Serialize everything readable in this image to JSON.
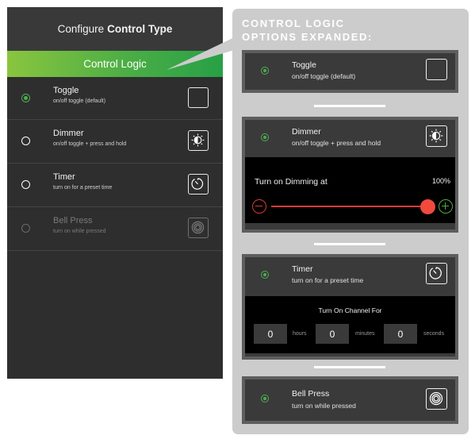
{
  "phone": {
    "header_prefix": "Configure",
    "header_bold": "Control Type",
    "section": "Control Logic",
    "items": [
      {
        "title": "Toggle",
        "subtitle": "on/off toggle (default)",
        "icon": "toggle-square-icon",
        "selected": true,
        "enabled": true
      },
      {
        "title": "Dimmer",
        "subtitle": "on/off toggle + press and hold",
        "icon": "brightness-icon",
        "selected": false,
        "enabled": true
      },
      {
        "title": "Timer",
        "subtitle": "turn on for a preset time",
        "icon": "timer-icon",
        "selected": false,
        "enabled": true
      },
      {
        "title": "Bell Press",
        "subtitle": "turn on while pressed",
        "icon": "bell-press-icon",
        "selected": false,
        "enabled": false
      }
    ]
  },
  "panel": {
    "title_line1": "CONTROL LOGIC",
    "title_line2": "OPTIONS EXPANDED:",
    "toggle": {
      "title": "Toggle",
      "subtitle": "on/off toggle (default)",
      "icon": "toggle-square-icon"
    },
    "dimmer": {
      "title": "Dimmer",
      "subtitle": "on/off toggle + press and hold",
      "icon": "brightness-icon",
      "dimming_label": "Turn on Dimming at",
      "level_text": "100%",
      "level": 100
    },
    "timer": {
      "title": "Timer",
      "subtitle": "turn on for a preset time",
      "icon": "timer-icon",
      "label": "Turn On Channel For",
      "hours": "0",
      "hours_unit": "hours",
      "minutes": "0",
      "minutes_unit": "minutes",
      "seconds": "0",
      "seconds_unit": "seconds"
    },
    "bell": {
      "title": "Bell Press",
      "subtitle": "turn on while pressed",
      "icon": "bell-press-icon"
    }
  },
  "colors": {
    "accent_green": "#4caf50",
    "gradient_start": "#8ac53f",
    "gradient_end": "#27a046",
    "slider_red": "#f04a3f",
    "plus_green": "#56a845",
    "panel_gray": "#cccccc"
  }
}
